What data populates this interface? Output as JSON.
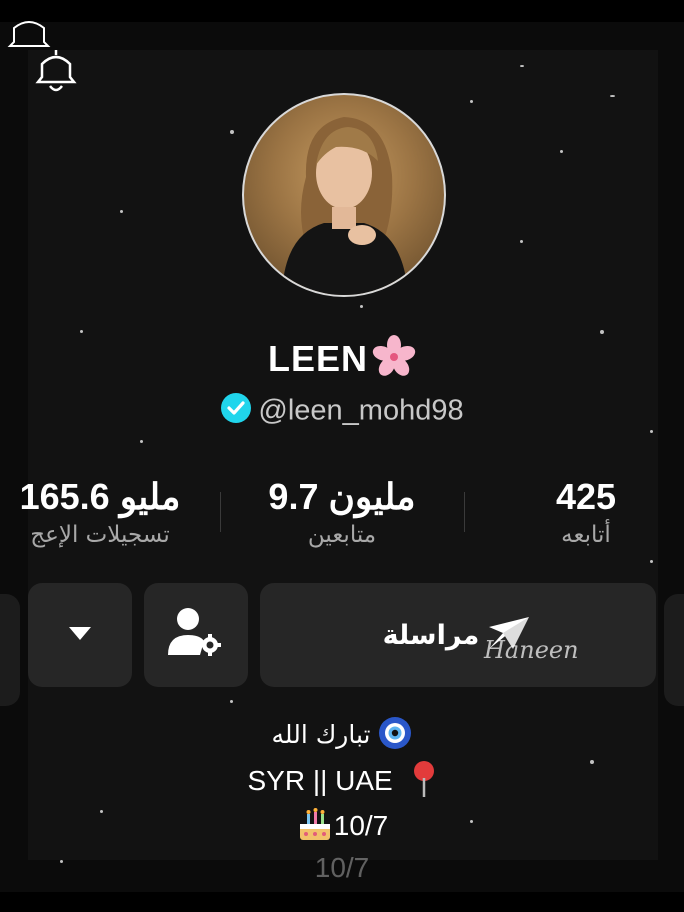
{
  "profile": {
    "display_name": "LEEN",
    "name_emoji": "cherry-blossom-icon",
    "handle": "@leen_mohd98",
    "verified": true
  },
  "stats": {
    "likes": {
      "value": "165.6 مليو",
      "label": "تسجيلات الإعج"
    },
    "followers": {
      "value": "9.7 مليون",
      "label": "متابعين"
    },
    "following": {
      "value": "425",
      "label": "أتابعه"
    }
  },
  "actions": {
    "message_label": "مراسلة",
    "message_icon": "send-icon",
    "friends_icon": "user-settings-icon",
    "more_icon": "chevron-down-icon"
  },
  "watermark": "Haneen",
  "bio": {
    "line1": "تبارك الله",
    "line1_icon": "evil-eye-icon",
    "line2": "SYR || UAE",
    "line2_icon": "location-pin-icon",
    "line3": "10/7",
    "line3_icon": "birthday-cake-icon",
    "ghost_line": "10/7"
  },
  "colors": {
    "background": "#000000",
    "panel": "#121212",
    "button": "#262626",
    "verified": "#20d5ec",
    "muted_text": "#a8a8a8"
  }
}
